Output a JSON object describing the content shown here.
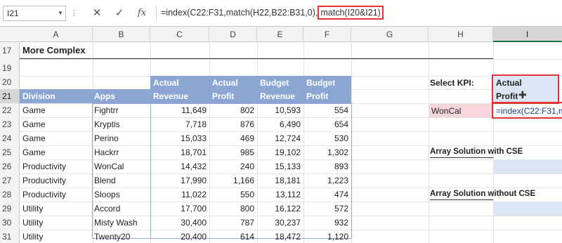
{
  "formula_bar": {
    "name_box": "I21",
    "separator": "⋮",
    "cancel_icon": "✕",
    "enter_icon": "✓",
    "function_icon": "fx",
    "formula_main": "=index(C22:F31,match(H22,B22:B31,0),",
    "formula_highlight": "match(I20&I21)"
  },
  "columns": [
    "A",
    "B",
    "C",
    "D",
    "E",
    "F",
    "G",
    "H",
    "I"
  ],
  "rows": [
    "17",
    "19",
    "20",
    "21",
    "22",
    "23",
    "24",
    "25",
    "26",
    "27",
    "28",
    "29",
    "30",
    "31"
  ],
  "title": "More Complex",
  "headers": {
    "division": "Division",
    "apps": "Apps",
    "c_top": "Actual",
    "c_bottom": "Revenue",
    "d_top": "Actual",
    "d_bottom": "Profit",
    "e_top": "Budget",
    "e_bottom": "Revenue",
    "f_top": "Budget",
    "f_bottom": "Profit"
  },
  "table": [
    [
      "Game",
      "Fightrr",
      "11,649",
      "802",
      "10,593",
      "554"
    ],
    [
      "Game",
      "Kryptis",
      "7,718",
      "876",
      "6,490",
      "654"
    ],
    [
      "Game",
      "Perino",
      "15,033",
      "469",
      "12,724",
      "530"
    ],
    [
      "Game",
      "Hackrr",
      "18,701",
      "985",
      "19,102",
      "1,302"
    ],
    [
      "Productivity",
      "WonCal",
      "14,432",
      "240",
      "15,133",
      "893"
    ],
    [
      "Productivity",
      "Blend",
      "17,990",
      "1,166",
      "18,181",
      "1,223"
    ],
    [
      "Productivity",
      "Sloops",
      "11,022",
      "550",
      "13,112",
      "474"
    ],
    [
      "Utility",
      "Accord",
      "17,700",
      "800",
      "16,122",
      "572"
    ],
    [
      "Utility",
      "Misty Wash",
      "30,400",
      "787",
      "30,237",
      "932"
    ],
    [
      "Utility",
      "Twenty20",
      "20,400",
      "614",
      "18,472",
      "1,120"
    ]
  ],
  "kpi": {
    "label": "Select KPI:",
    "i20": "Actual",
    "i21": "Profit",
    "h22": "WonCal",
    "i22": "=index(C22:F31,m",
    "array_cse": "Array Solution with CSE",
    "array_no_cse": "Array Solution without CSE"
  }
}
